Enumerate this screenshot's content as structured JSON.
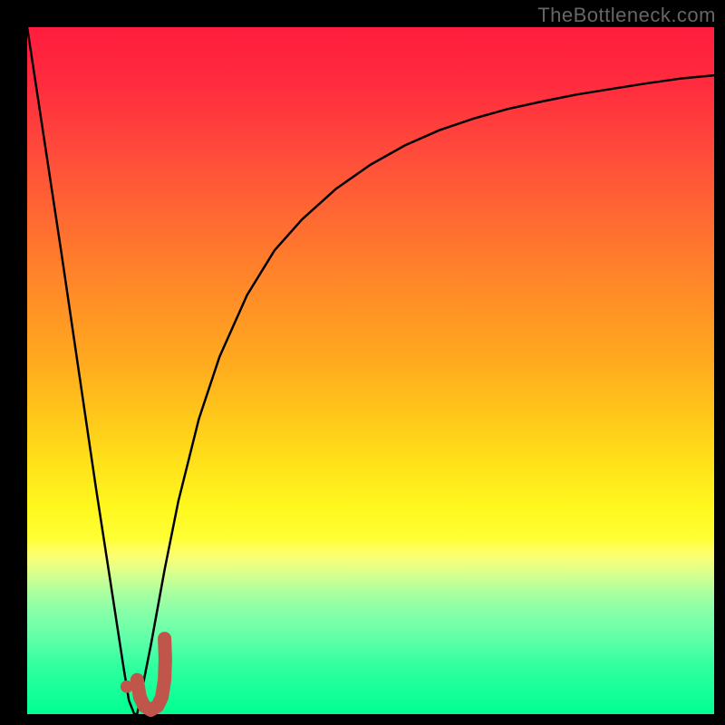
{
  "watermark": "TheBottleneck.com",
  "colors": {
    "frame": "#000000",
    "curve": "#000000",
    "marker": "#c0564b",
    "watermark_text": "#666666"
  },
  "chart_data": {
    "type": "line",
    "title": "",
    "xlabel": "",
    "ylabel": "",
    "xlim": [
      0,
      100
    ],
    "ylim": [
      0,
      100
    ],
    "series": [
      {
        "name": "bottleneck-curve",
        "x": [
          0,
          5,
          10,
          12,
          14,
          14.8,
          15.6,
          16,
          18,
          20,
          22,
          25,
          28,
          32,
          36,
          40,
          45,
          50,
          55,
          60,
          65,
          70,
          75,
          80,
          85,
          90,
          95,
          100
        ],
        "values": [
          100,
          67,
          33,
          20,
          7,
          2,
          0,
          0,
          10,
          21,
          31,
          43,
          52,
          61,
          67.5,
          72,
          76.5,
          80,
          82.8,
          85,
          86.7,
          88.1,
          89.2,
          90.2,
          91,
          91.8,
          92.5,
          93
        ]
      }
    ],
    "annotations": [
      {
        "name": "marker-dot",
        "type": "point",
        "x": 14.5,
        "y": 4
      },
      {
        "name": "marker-hook",
        "type": "path",
        "points_x": [
          16.0,
          16.4,
          17.0,
          18.0,
          19.0,
          19.6,
          20.0,
          20.1,
          20.0
        ],
        "points_y": [
          5.0,
          2.5,
          1.2,
          0.6,
          1.2,
          2.5,
          5.0,
          8.0,
          11.0
        ]
      }
    ]
  }
}
